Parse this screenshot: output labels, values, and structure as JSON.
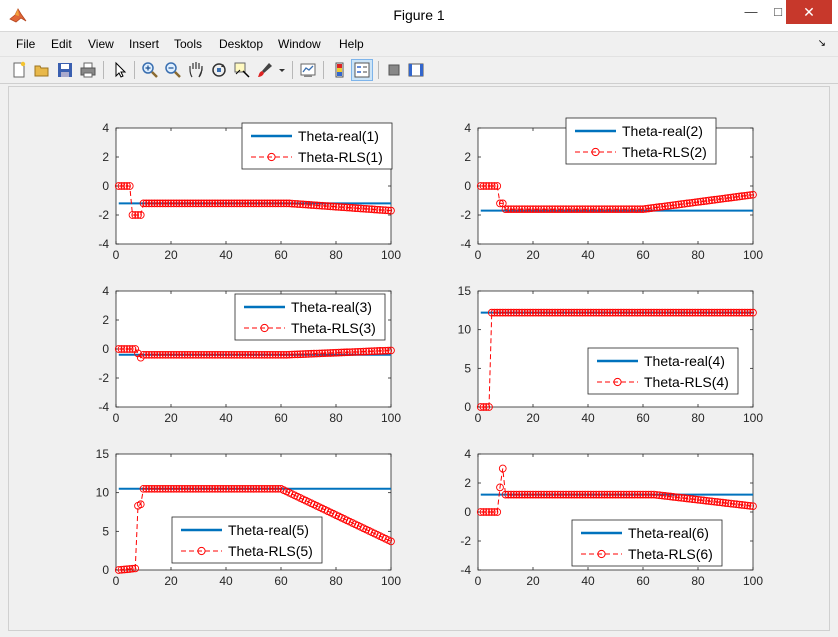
{
  "window": {
    "title": "Figure 1"
  },
  "menu": [
    "File",
    "Edit",
    "View",
    "Insert",
    "Tools",
    "Desktop",
    "Window",
    "Help"
  ],
  "toolbar": [
    "new-figure-icon",
    "open-file-icon",
    "save-icon",
    "print-icon",
    "pointer-icon",
    "zoom-in-icon",
    "zoom-out-icon",
    "pan-icon",
    "rotate-3d-icon",
    "data-cursor-icon",
    "brush-icon",
    "brush-menu-icon",
    "link-plot-icon",
    "colorbar-icon",
    "legend-icon",
    "hide-plot-tools-icon",
    "show-plot-tools-icon"
  ],
  "colors": {
    "real": "#0072bd",
    "rls": "#ff0000"
  },
  "chart_data": [
    {
      "type": "line",
      "xlim": [
        0,
        100
      ],
      "ylim": [
        -4,
        4
      ],
      "xticks": [
        0,
        20,
        40,
        60,
        80,
        100
      ],
      "yticks": [
        -4,
        -2,
        0,
        2,
        4
      ],
      "legend_loc": "top-right",
      "series": [
        {
          "name": "Theta-real(1)",
          "style": "solid",
          "x": [
            1,
            100
          ],
          "y": [
            -1.2,
            -1.2
          ]
        },
        {
          "name": "Theta-RLS(1)",
          "style": "dashed-circle",
          "segments": [
            [
              1,
              0
            ],
            [
              4,
              0
            ],
            [
              5,
              0
            ],
            [
              6,
              -2
            ],
            [
              9,
              -2
            ],
            [
              10,
              -1.2
            ],
            [
              63,
              -1.2
            ],
            [
              100,
              -1.7
            ]
          ]
        }
      ]
    },
    {
      "type": "line",
      "xlim": [
        0,
        100
      ],
      "ylim": [
        -4,
        4
      ],
      "xticks": [
        0,
        20,
        40,
        60,
        80,
        100
      ],
      "yticks": [
        -4,
        -2,
        0,
        2,
        4
      ],
      "legend_loc": "top-right",
      "series": [
        {
          "name": "Theta-real(2)",
          "style": "solid",
          "x": [
            1,
            100
          ],
          "y": [
            -1.7,
            -1.7
          ]
        },
        {
          "name": "Theta-RLS(2)",
          "style": "dashed-circle",
          "segments": [
            [
              1,
              0
            ],
            [
              6,
              0
            ],
            [
              7,
              0
            ],
            [
              8,
              -1.2
            ],
            [
              9,
              -1.2
            ],
            [
              10,
              -1.6
            ],
            [
              60,
              -1.6
            ],
            [
              100,
              -0.6
            ]
          ]
        }
      ]
    },
    {
      "type": "line",
      "xlim": [
        0,
        100
      ],
      "ylim": [
        -4,
        4
      ],
      "xticks": [
        0,
        20,
        40,
        60,
        80,
        100
      ],
      "yticks": [
        -4,
        -2,
        0,
        2,
        4
      ],
      "legend_loc": "top-right",
      "series": [
        {
          "name": "Theta-real(3)",
          "style": "solid",
          "x": [
            1,
            100
          ],
          "y": [
            -0.4,
            -0.4
          ]
        },
        {
          "name": "Theta-RLS(3)",
          "style": "dashed-circle",
          "segments": [
            [
              1,
              0
            ],
            [
              7,
              0
            ],
            [
              8,
              -0.3
            ],
            [
              9,
              -0.6
            ],
            [
              10,
              -0.4
            ],
            [
              62,
              -0.4
            ],
            [
              100,
              -0.1
            ]
          ]
        }
      ]
    },
    {
      "type": "line",
      "xlim": [
        0,
        100
      ],
      "ylim": [
        0,
        15
      ],
      "xticks": [
        0,
        20,
        40,
        60,
        80,
        100
      ],
      "yticks": [
        0,
        5,
        10,
        15
      ],
      "legend_loc": "bottom-right",
      "series": [
        {
          "name": "Theta-real(4)",
          "style": "solid",
          "x": [
            1,
            100
          ],
          "y": [
            12.2,
            12.2
          ]
        },
        {
          "name": "Theta-RLS(4)",
          "style": "dashed-circle",
          "segments": [
            [
              1,
              0
            ],
            [
              4,
              0
            ],
            [
              5,
              12.2
            ],
            [
              100,
              12.2
            ]
          ]
        }
      ]
    },
    {
      "type": "line",
      "xlim": [
        0,
        100
      ],
      "ylim": [
        0,
        15
      ],
      "xticks": [
        0,
        20,
        40,
        60,
        80,
        100
      ],
      "yticks": [
        0,
        5,
        10,
        15
      ],
      "legend_loc": "bottom-right",
      "series": [
        {
          "name": "Theta-real(5)",
          "style": "solid",
          "x": [
            1,
            100
          ],
          "y": [
            10.5,
            10.5
          ]
        },
        {
          "name": "Theta-RLS(5)",
          "style": "dashed-circle",
          "segments": [
            [
              1,
              0
            ],
            [
              7,
              0.2
            ],
            [
              8,
              8.3
            ],
            [
              9,
              8.5
            ],
            [
              10,
              10.5
            ],
            [
              60,
              10.5
            ],
            [
              100,
              3.7
            ]
          ]
        }
      ]
    },
    {
      "type": "line",
      "xlim": [
        0,
        100
      ],
      "ylim": [
        -4,
        4
      ],
      "xticks": [
        0,
        20,
        40,
        60,
        80,
        100
      ],
      "yticks": [
        -4,
        -2,
        0,
        2,
        4
      ],
      "legend_loc": "bottom-right",
      "series": [
        {
          "name": "Theta-real(6)",
          "style": "solid",
          "x": [
            1,
            100
          ],
          "y": [
            1.2,
            1.2
          ]
        },
        {
          "name": "Theta-RLS(6)",
          "style": "dashed-circle",
          "segments": [
            [
              1,
              0
            ],
            [
              7,
              0
            ],
            [
              8,
              1.7
            ],
            [
              9,
              3
            ],
            [
              10,
              1.2
            ],
            [
              64,
              1.2
            ],
            [
              100,
              0.4
            ]
          ]
        }
      ]
    }
  ]
}
